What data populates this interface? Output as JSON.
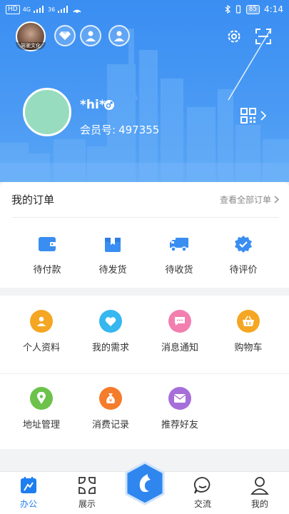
{
  "status_bar": {
    "left_chips": [
      "HD",
      "4G",
      "36"
    ],
    "time": "4:14",
    "battery": "85"
  },
  "header": {
    "top_avatar_caption": "驾驶文化"
  },
  "profile": {
    "nickname": "*hi*",
    "member_label": "会员号:",
    "member_number": "497355"
  },
  "orders": {
    "title": "我的订单",
    "view_all": "查看全部订单",
    "items": [
      {
        "label": "待付款",
        "icon": "wallet-icon"
      },
      {
        "label": "待发货",
        "icon": "box-icon"
      },
      {
        "label": "待收货",
        "icon": "truck-icon"
      },
      {
        "label": "待评价",
        "icon": "check-badge-icon"
      }
    ]
  },
  "services": {
    "items": [
      {
        "label": "个人资料",
        "icon": "person-icon",
        "color": "#f5a623"
      },
      {
        "label": "我的需求",
        "icon": "heart-icon",
        "color": "#36b7f0"
      },
      {
        "label": "消息通知",
        "icon": "chat-icon",
        "color": "#f27fb0"
      },
      {
        "label": "购物车",
        "icon": "basket-icon",
        "color": "#f5a623"
      },
      {
        "label": "地址管理",
        "icon": "location-icon",
        "color": "#6cc24a"
      },
      {
        "label": "消费记录",
        "icon": "money-bag-icon",
        "color": "#f57c2a"
      },
      {
        "label": "推荐好友",
        "icon": "mail-icon",
        "color": "#a66ed8"
      }
    ]
  },
  "bottom_nav": {
    "items": [
      {
        "label": "办公",
        "active": true
      },
      {
        "label": "展示",
        "active": false
      },
      {
        "label": "交流",
        "active": false
      },
      {
        "label": "我的",
        "active": false
      }
    ]
  },
  "colors": {
    "brand_blue": "#3a8ef2",
    "active_nav": "#1e7ef0"
  }
}
